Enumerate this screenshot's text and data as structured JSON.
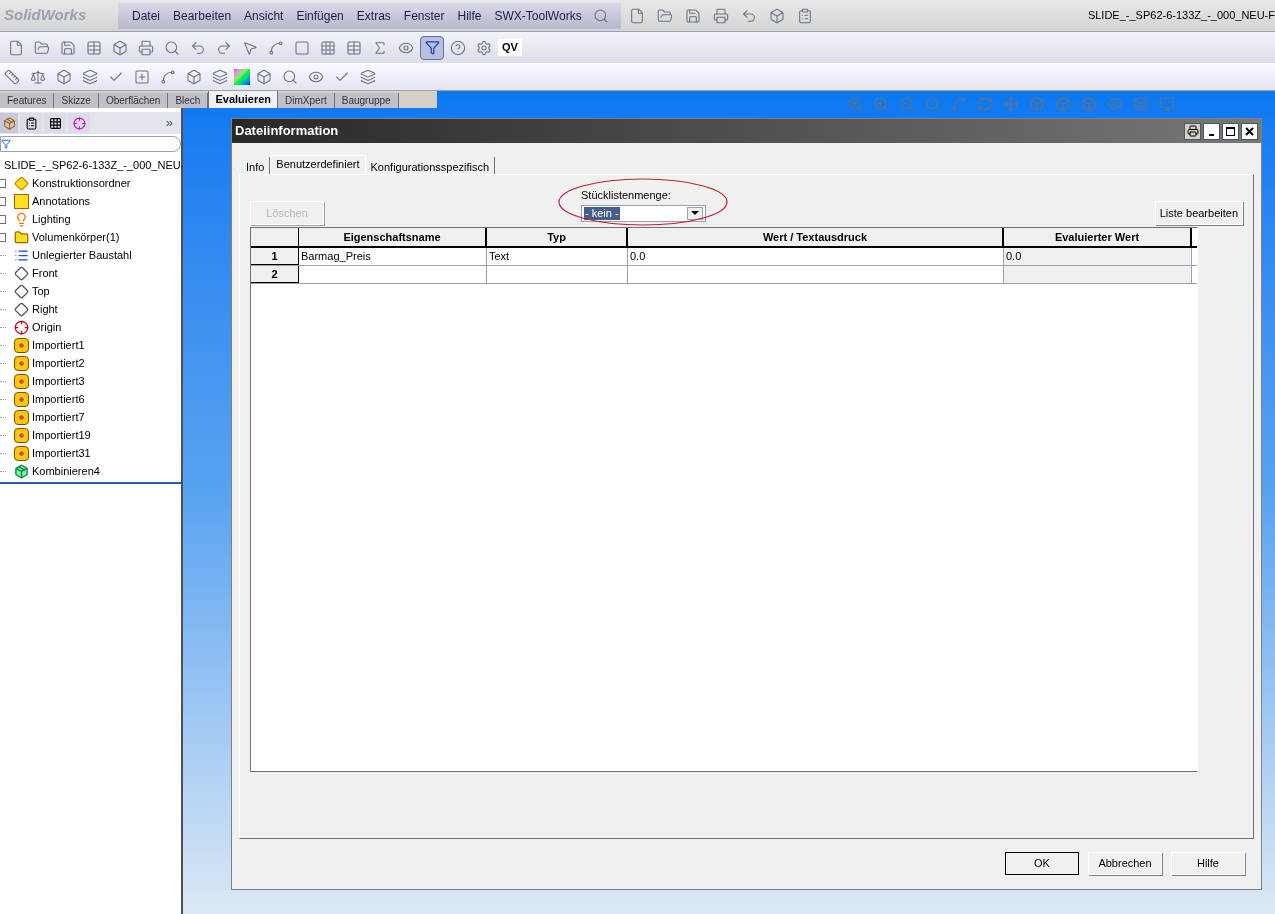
{
  "app": {
    "logo": "SolidWorks",
    "menu": [
      "Datei",
      "Bearbeiten",
      "Ansicht",
      "Einfügen",
      "Extras",
      "Fenster",
      "Hilfe",
      "SWX-ToolWorks"
    ],
    "document_title": "SLIDE_-_SP62-6-133Z_-_000_NEU-F"
  },
  "toolbar": {
    "quick_view_label": "QV"
  },
  "command_tabs": [
    {
      "label": "Features",
      "selected": false
    },
    {
      "label": "Skizze",
      "selected": false
    },
    {
      "label": "Oberflächen",
      "selected": false
    },
    {
      "label": "Blech",
      "selected": false
    },
    {
      "label": "Evaluieren",
      "selected": true
    },
    {
      "label": "DimXpert",
      "selected": false
    },
    {
      "label": "Baugruppe",
      "selected": false
    }
  ],
  "feature_manager": {
    "more_label": "»",
    "tree": {
      "label": "SLIDE_-_SP62-6-133Z_-_000_NEU-",
      "children": [
        {
          "label": "Konstruktionsordner",
          "expandable": true
        },
        {
          "label": "Annotations",
          "expandable": true
        },
        {
          "label": "Lighting",
          "expandable": true
        },
        {
          "label": "Volumenkörper(1)",
          "expandable": true
        },
        {
          "label": "Unlegierter Baustahl",
          "expandable": false
        },
        {
          "label": "Front",
          "expandable": false
        },
        {
          "label": "Top",
          "expandable": false
        },
        {
          "label": "Right",
          "expandable": false
        },
        {
          "label": "Origin",
          "expandable": false
        },
        {
          "label": "Importiert1",
          "expandable": false
        },
        {
          "label": "Importiert2",
          "expandable": false
        },
        {
          "label": "Importiert3",
          "expandable": false
        },
        {
          "label": "Importiert6",
          "expandable": false
        },
        {
          "label": "Importiert7",
          "expandable": false
        },
        {
          "label": "Importiert19",
          "expandable": false
        },
        {
          "label": "Importiert31",
          "expandable": false
        },
        {
          "label": "Kombinieren4",
          "expandable": false
        }
      ]
    }
  },
  "dialog": {
    "title": "Dateiinformation",
    "tabs": [
      {
        "label": "Info",
        "selected": false
      },
      {
        "label": "Benutzerdefiniert",
        "selected": true
      },
      {
        "label": "Konfigurationsspezifisch",
        "selected": false
      }
    ],
    "delete_button": {
      "label": "Löschen",
      "disabled": true
    },
    "bom_quantity": {
      "label": "Stücklistenmenge:",
      "value": "- kein -",
      "highlighted": true
    },
    "edit_list_button": "Liste bearbeiten",
    "table": {
      "columns": [
        "Eigenschaftsname",
        "Typ",
        "Wert / Textausdruck",
        "Evaluierter Wert"
      ],
      "rows": [
        {
          "number": "1",
          "cells": [
            "Barmag_Preis",
            "Text",
            "0.0",
            "0.0"
          ]
        },
        {
          "number": "2",
          "cells": []
        }
      ]
    },
    "buttons": [
      "OK",
      "Abbrechen",
      "Hilfe"
    ]
  }
}
